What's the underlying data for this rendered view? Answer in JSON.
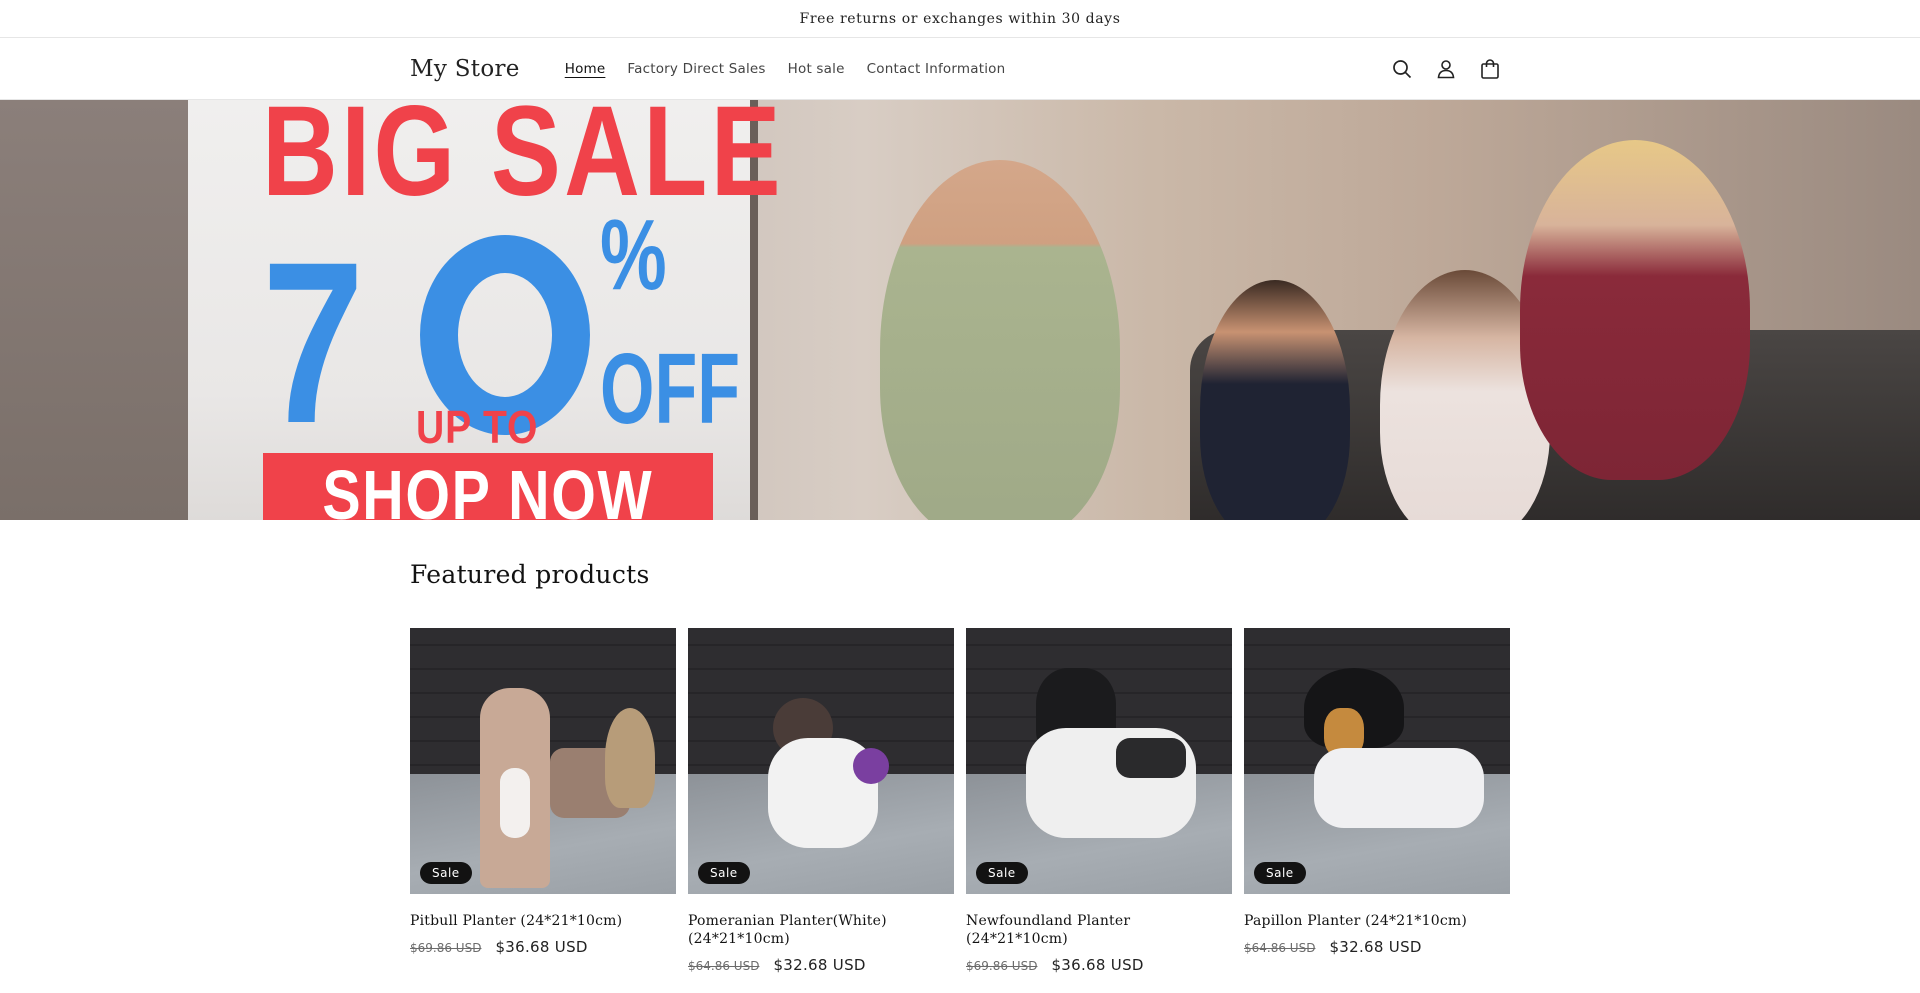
{
  "announcement": {
    "text": "Free returns or exchanges within 30 days"
  },
  "header": {
    "logo": "My Store",
    "nav": [
      {
        "label": "Home"
      },
      {
        "label": "Factory Direct Sales"
      },
      {
        "label": "Hot sale"
      },
      {
        "label": "Contact Information"
      }
    ],
    "icons": [
      "search-icon",
      "account-icon",
      "cart-icon"
    ]
  },
  "banner": {
    "headline": "BIG SALE",
    "number": "7",
    "up_to": "UP TO",
    "percent": "%",
    "off": "OFF",
    "cta": "SHOP NOW",
    "colors": {
      "red": "#f0424a",
      "blue": "#3b8fe4"
    }
  },
  "featured": {
    "title": "Featured products",
    "products": [
      {
        "title": "Pitbull Planter (24*21*10cm)",
        "badge": "Sale",
        "compare_price": "$69.86 USD",
        "price": "$36.68 USD"
      },
      {
        "title": "Pomeranian Planter(White) (24*21*10cm)",
        "badge": "Sale",
        "compare_price": "$64.86 USD",
        "price": "$32.68 USD"
      },
      {
        "title": "Newfoundland Planter (24*21*10cm)",
        "badge": "Sale",
        "compare_price": "$69.86 USD",
        "price": "$36.68 USD"
      },
      {
        "title": "Papillon Planter (24*21*10cm)",
        "badge": "Sale",
        "compare_price": "$64.86 USD",
        "price": "$32.68 USD"
      }
    ]
  }
}
